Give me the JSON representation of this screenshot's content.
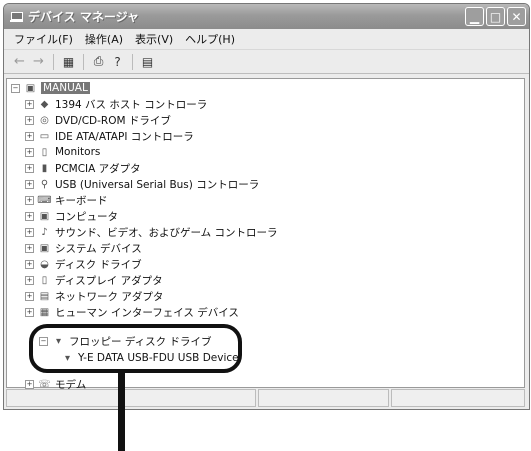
{
  "window": {
    "title": "デバイス マネージャ"
  },
  "menubar": [
    "ファイル(F)",
    "操作(A)",
    "表示(V)",
    "ヘルプ(H)"
  ],
  "tree": {
    "root": "MANUAL",
    "items": [
      "1394 バス ホスト コントローラ",
      "DVD/CD-ROM ドライブ",
      "IDE ATA/ATAPI コントローラ",
      "Monitors",
      "PCMCIA アダプタ",
      "USB (Universal Serial Bus) コントローラ",
      "キーボード",
      "コンピュータ",
      "サウンド、ビデオ、およびゲーム コントローラ",
      "システム デバイス",
      "ディスク ドライブ",
      "ディスプレイ アダプタ",
      "ネットワーク アダプタ",
      "ヒューマン インターフェイス デバイス"
    ],
    "floppy": {
      "label": "フロッピー ディスク ドライブ",
      "child": "Y-E DATA USB-FDU USB Device"
    },
    "modem": "モデム"
  }
}
